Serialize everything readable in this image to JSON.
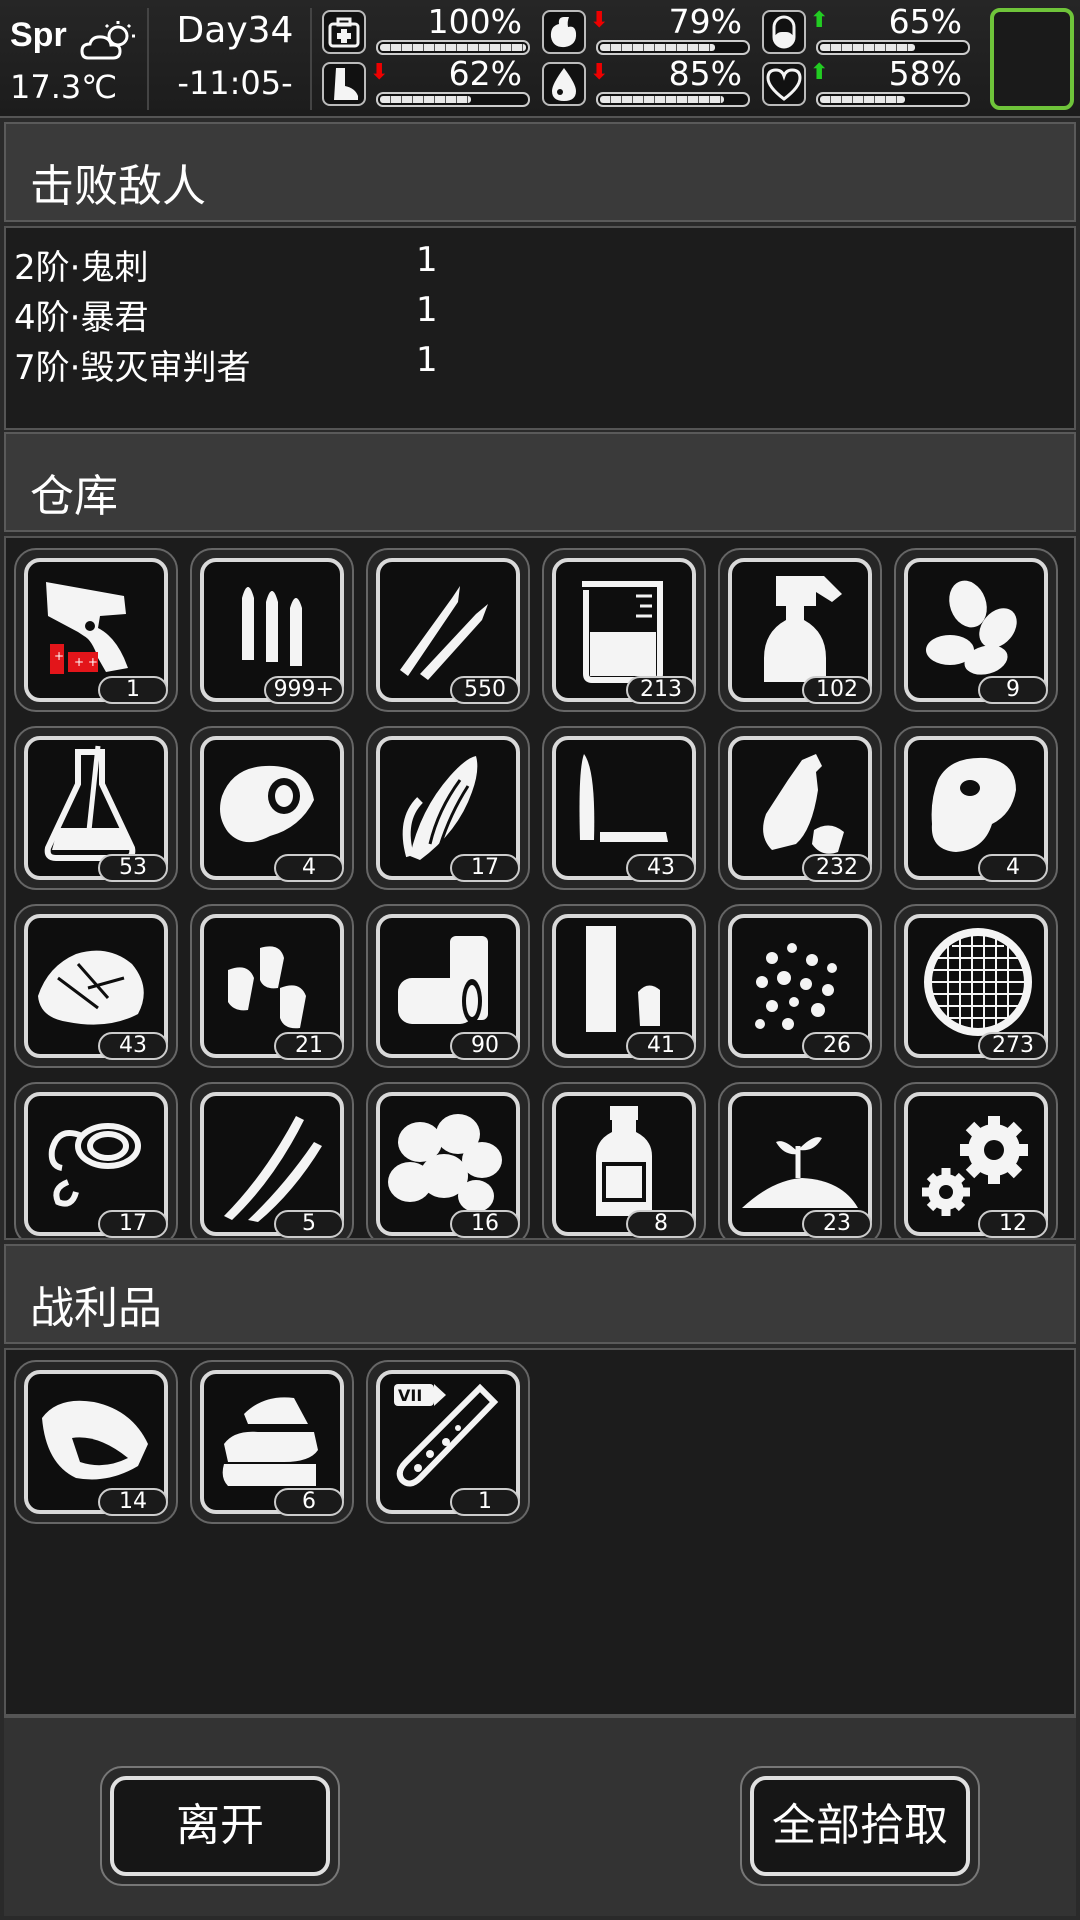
{
  "status": {
    "season": "Spr",
    "temperature": "17.3℃",
    "day": "Day34",
    "time": "-11:05-",
    "stats": [
      {
        "name": "health-icon",
        "value": "100%",
        "fraction": 1.0,
        "trend": ""
      },
      {
        "name": "stomach-icon",
        "value": "79%",
        "fraction": 0.79,
        "trend": "down"
      },
      {
        "name": "pill-icon",
        "value": "65%",
        "fraction": 0.65,
        "trend": "up"
      },
      {
        "name": "foot-icon",
        "value": "62%",
        "fraction": 0.62,
        "trend": "down"
      },
      {
        "name": "water-drop-icon",
        "value": "85%",
        "fraction": 0.85,
        "trend": "down"
      },
      {
        "name": "heart-icon",
        "value": "58%",
        "fraction": 0.58,
        "trend": "up"
      }
    ]
  },
  "defeated": {
    "title": "击败敌人",
    "enemies": [
      {
        "name": "2阶·鬼刺",
        "count": "1"
      },
      {
        "name": "4阶·暴君",
        "count": "1"
      },
      {
        "name": "7阶·毁灭审判者",
        "count": "1"
      }
    ]
  },
  "warehouse": {
    "title": "仓库",
    "items": [
      {
        "icon": "flare-gun-icon",
        "qty": "1"
      },
      {
        "icon": "bullets-icon",
        "qty": "999+"
      },
      {
        "icon": "rifle-rounds-icon",
        "qty": "550"
      },
      {
        "icon": "beaker-icon",
        "qty": "213"
      },
      {
        "icon": "spray-bottle-icon",
        "qty": "102"
      },
      {
        "icon": "seeds-icon",
        "qty": "9"
      },
      {
        "icon": "flask-icon",
        "qty": "53"
      },
      {
        "icon": "cloth-ball-icon",
        "qty": "4"
      },
      {
        "icon": "corn-icon",
        "qty": "17"
      },
      {
        "icon": "shell-casings-icon",
        "qty": "43"
      },
      {
        "icon": "plastic-bottle-icon",
        "qty": "232"
      },
      {
        "icon": "meat-steak-icon",
        "qty": "4"
      },
      {
        "icon": "fiber-pile-icon",
        "qty": "43"
      },
      {
        "icon": "bullet-tips-icon",
        "qty": "21"
      },
      {
        "icon": "cans-icon",
        "qty": "90"
      },
      {
        "icon": "shotgun-shell-icon",
        "qty": "41"
      },
      {
        "icon": "pellets-icon",
        "qty": "26"
      },
      {
        "icon": "mesh-filter-icon",
        "qty": "273"
      },
      {
        "icon": "rope-icon",
        "qty": "17"
      },
      {
        "icon": "wires-icon",
        "qty": "5"
      },
      {
        "icon": "rock-pile-icon",
        "qty": "16"
      },
      {
        "icon": "medicine-bottle-icon",
        "qty": "8"
      },
      {
        "icon": "soil-sprout-icon",
        "qty": "23"
      },
      {
        "icon": "gears-icon",
        "qty": "12"
      }
    ]
  },
  "loot": {
    "title": "战利品",
    "items": [
      {
        "icon": "meat-chunk-icon",
        "qty": "14"
      },
      {
        "icon": "cloth-stack-icon",
        "qty": "6"
      },
      {
        "icon": "syringe-vial-icon",
        "qty": "1",
        "badge": "VII"
      }
    ]
  },
  "buttons": {
    "leave": "离开",
    "pick_all": "全部拾取"
  }
}
